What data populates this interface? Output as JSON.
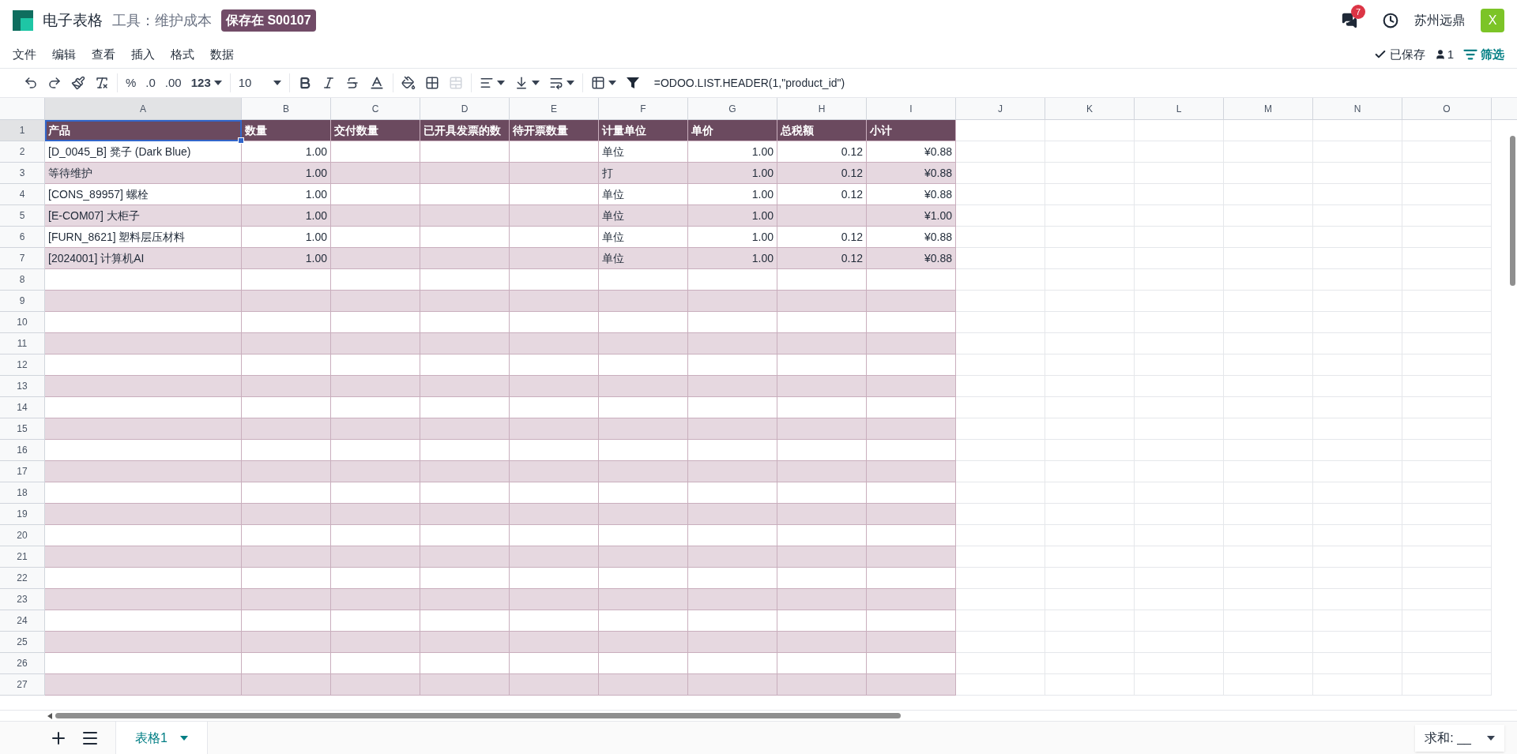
{
  "header": {
    "app_title": "电子表格",
    "breadcrumb": "工具：维护成本",
    "badge": "保存在 S00107",
    "notification_count": "7",
    "user_name": "苏州远鼎",
    "avatar_letter": "X"
  },
  "menu": [
    "文件",
    "编辑",
    "查看",
    "插入",
    "格式",
    "数据"
  ],
  "status": {
    "saved": "已保存",
    "users": "1",
    "filter": "筛选"
  },
  "toolbar": {
    "number_formats": [
      "%",
      ".0",
      ".00"
    ],
    "more_formats": "123",
    "font_size": "10"
  },
  "formula": "=ODOO.LIST.HEADER(1,\"product_id\")",
  "columns": [
    {
      "letter": "A",
      "selected": true,
      "numeric": false,
      "in_table": true
    },
    {
      "letter": "B",
      "selected": false,
      "numeric": true,
      "in_table": true
    },
    {
      "letter": "C",
      "selected": false,
      "numeric": false,
      "in_table": true
    },
    {
      "letter": "D",
      "selected": false,
      "numeric": false,
      "in_table": true
    },
    {
      "letter": "E",
      "selected": false,
      "numeric": false,
      "in_table": true
    },
    {
      "letter": "F",
      "selected": false,
      "numeric": false,
      "in_table": true
    },
    {
      "letter": "G",
      "selected": false,
      "numeric": true,
      "in_table": true
    },
    {
      "letter": "H",
      "selected": false,
      "numeric": true,
      "in_table": true
    },
    {
      "letter": "I",
      "selected": false,
      "numeric": true,
      "in_table": true
    },
    {
      "letter": "J",
      "selected": false,
      "numeric": false,
      "in_table": false
    },
    {
      "letter": "K",
      "selected": false,
      "numeric": false,
      "in_table": false
    },
    {
      "letter": "L",
      "selected": false,
      "numeric": false,
      "in_table": false
    },
    {
      "letter": "M",
      "selected": false,
      "numeric": false,
      "in_table": false
    },
    {
      "letter": "N",
      "selected": false,
      "numeric": false,
      "in_table": false
    },
    {
      "letter": "O",
      "selected": false,
      "numeric": false,
      "in_table": false
    }
  ],
  "rows": [
    {
      "number": "1",
      "kind": "header",
      "selected": true,
      "cells": {
        "A": "产品",
        "B": "数量",
        "C": "交付数量",
        "D": "已开具发票的数",
        "E": "待开票数量",
        "F": "计量单位",
        "G": "单价",
        "H": "总税额",
        "I": "小计"
      }
    },
    {
      "number": "2",
      "kind": "data",
      "selected": false,
      "cells": {
        "A": "[D_0045_B] 凳子 (Dark Blue)",
        "B": "1.00",
        "F": "单位",
        "G": "1.00",
        "H": "0.12",
        "I": "¥0.88"
      }
    },
    {
      "number": "3",
      "kind": "data",
      "selected": false,
      "cells": {
        "A": "等待维护",
        "B": "1.00",
        "F": "打",
        "G": "1.00",
        "H": "0.12",
        "I": "¥0.88"
      }
    },
    {
      "number": "4",
      "kind": "data",
      "selected": false,
      "cells": {
        "A": "[CONS_89957] 螺栓",
        "B": "1.00",
        "F": "单位",
        "G": "1.00",
        "H": "0.12",
        "I": "¥0.88"
      }
    },
    {
      "number": "5",
      "kind": "data",
      "selected": false,
      "cells": {
        "A": "[E-COM07] 大柜子",
        "B": "1.00",
        "F": "单位",
        "G": "1.00",
        "I": "¥1.00"
      }
    },
    {
      "number": "6",
      "kind": "data",
      "selected": false,
      "cells": {
        "A": "[FURN_8621] 塑料层压材料",
        "B": "1.00",
        "F": "单位",
        "G": "1.00",
        "H": "0.12",
        "I": "¥0.88"
      }
    },
    {
      "number": "7",
      "kind": "data",
      "selected": false,
      "cells": {
        "A": "[2024001] 计算机AI",
        "B": "1.00",
        "F": "单位",
        "G": "1.00",
        "H": "0.12",
        "I": "¥0.88"
      }
    },
    {
      "number": "8",
      "kind": "data",
      "selected": false
    },
    {
      "number": "9",
      "kind": "data",
      "selected": false
    },
    {
      "number": "10",
      "kind": "data",
      "selected": false
    },
    {
      "number": "11",
      "kind": "data",
      "selected": false
    },
    {
      "number": "12",
      "kind": "data",
      "selected": false
    },
    {
      "number": "13",
      "kind": "data",
      "selected": false
    },
    {
      "number": "14",
      "kind": "data",
      "selected": false
    },
    {
      "number": "15",
      "kind": "data",
      "selected": false
    },
    {
      "number": "16",
      "kind": "data",
      "selected": false
    },
    {
      "number": "17",
      "kind": "data",
      "selected": false
    },
    {
      "number": "18",
      "kind": "data",
      "selected": false
    },
    {
      "number": "19",
      "kind": "data",
      "selected": false
    },
    {
      "number": "20",
      "kind": "data",
      "selected": false
    },
    {
      "number": "21",
      "kind": "data",
      "selected": false
    },
    {
      "number": "22",
      "kind": "data",
      "selected": false
    },
    {
      "number": "23",
      "kind": "data",
      "selected": false
    },
    {
      "number": "24",
      "kind": "data",
      "selected": false
    },
    {
      "number": "25",
      "kind": "data",
      "selected": false
    },
    {
      "number": "26",
      "kind": "data",
      "selected": false
    },
    {
      "number": "27",
      "kind": "data",
      "selected": false
    }
  ],
  "sheets": [
    {
      "name": "表格1",
      "selected": true
    }
  ],
  "aggregate": "求和: __"
}
